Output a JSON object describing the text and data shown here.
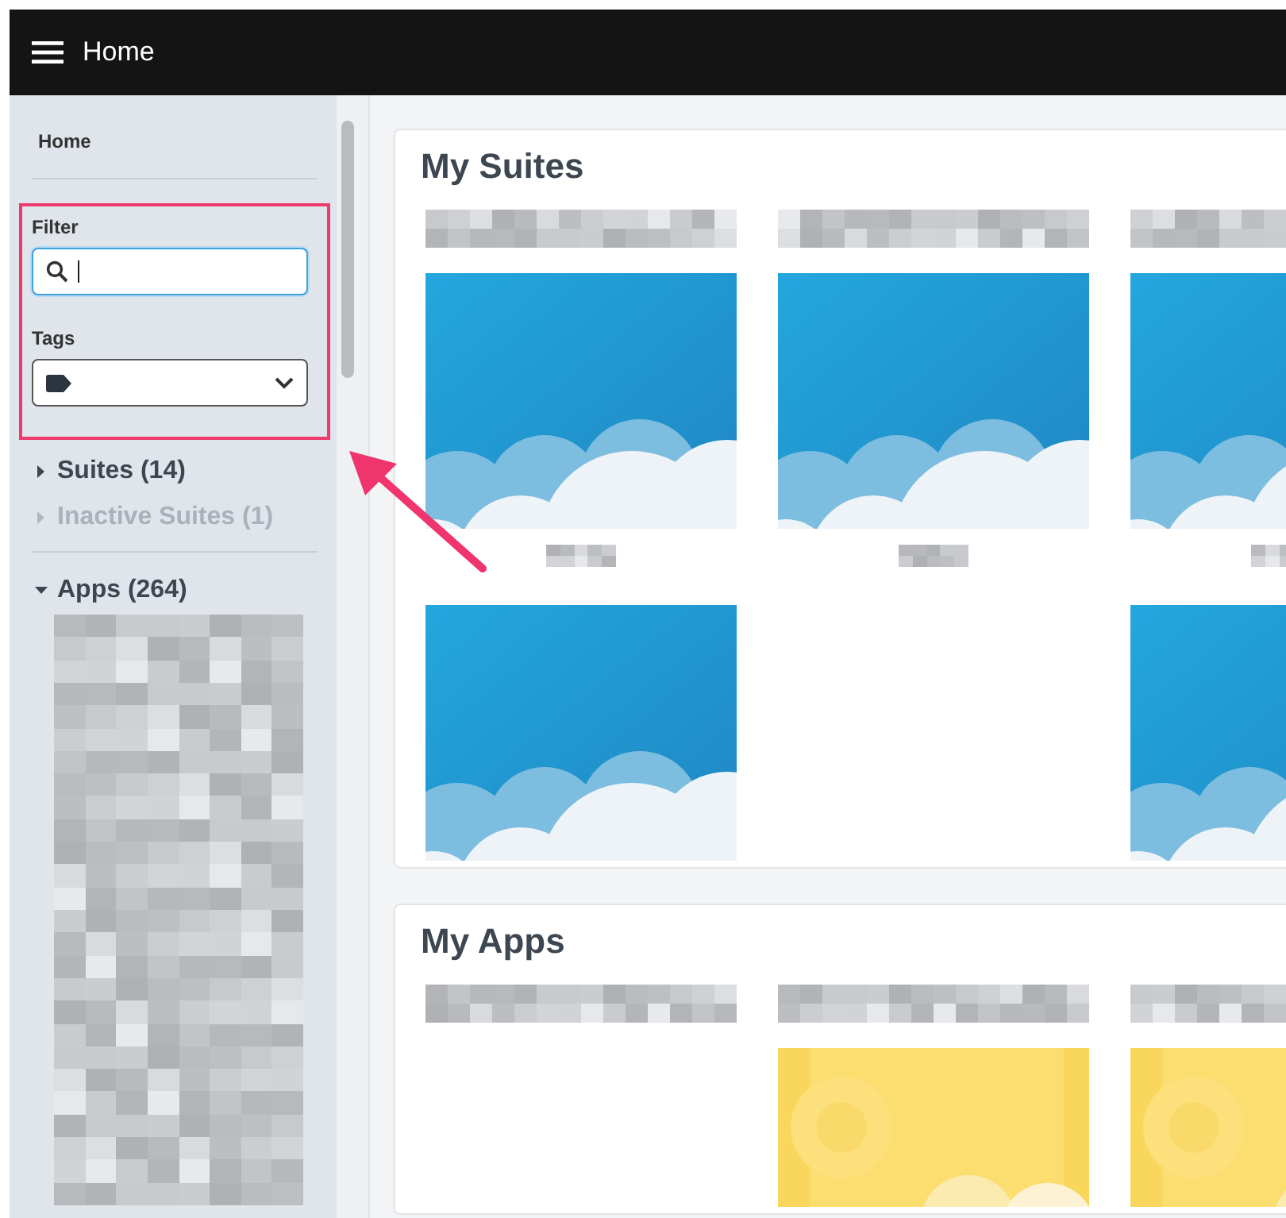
{
  "top_bar": {
    "title": "Home"
  },
  "sidebar": {
    "home_link": "Home",
    "filter": {
      "label": "Filter",
      "focused": true
    },
    "tags": {
      "label": "Tags"
    },
    "tree": [
      {
        "label": "Suites (14)",
        "expanded": false,
        "disabled": false
      },
      {
        "label": "Inactive Suites (1)",
        "expanded": false,
        "disabled": true
      }
    ],
    "apps": {
      "label": "Apps (264)",
      "expanded": true,
      "list_blurred": true
    }
  },
  "sections": [
    {
      "title": "My Suites",
      "tiles": [
        {
          "caption_above_blurred": true,
          "kind": "sky",
          "caption_below_blurred": true
        },
        {
          "caption_above_blurred": true,
          "kind": "sky",
          "caption_below_blurred": true
        },
        {
          "caption_above_blurred": true,
          "kind": "sky",
          "caption_below_blurred": true
        },
        {
          "kind": "sky"
        },
        {
          "kind": "empty"
        },
        {
          "kind": "sky"
        }
      ]
    },
    {
      "title": "My Apps",
      "tiles": [
        {
          "caption_above_blurred": true,
          "kind": "empty"
        },
        {
          "caption_above_blurred": true,
          "kind": "sun"
        },
        {
          "caption_above_blurred": true,
          "kind": "sun"
        }
      ]
    }
  ],
  "annotations": {
    "highlight": true,
    "arrow": true
  }
}
